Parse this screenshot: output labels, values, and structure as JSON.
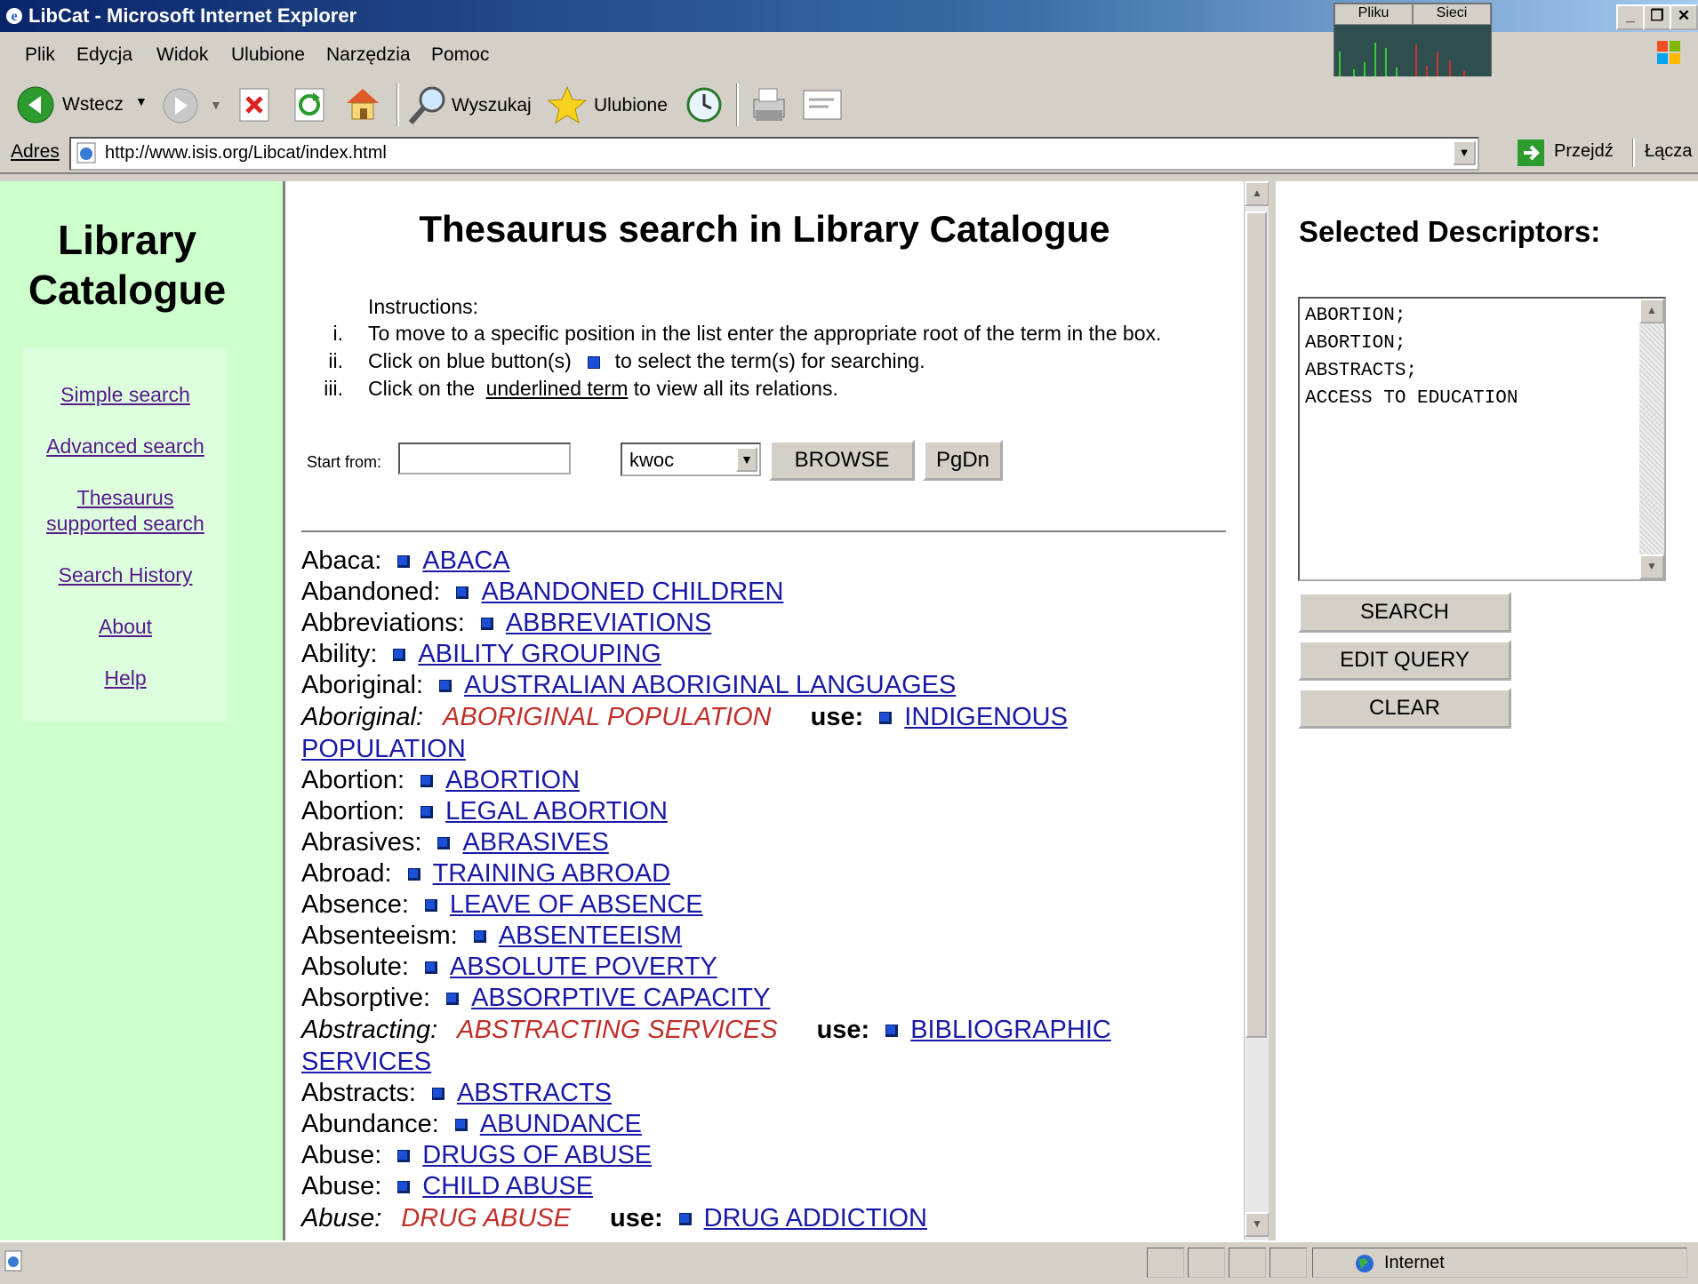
{
  "window": {
    "title": "LibCat - Microsoft Internet Explorer",
    "netmon_labels": [
      "Pliku",
      "Sieci"
    ],
    "buttons": [
      "_",
      "❐",
      "✕"
    ]
  },
  "menu": [
    "Plik",
    "Edycja",
    "Widok",
    "Ulubione",
    "Narzędzia",
    "Pomoc"
  ],
  "toolbar": {
    "back": "Wstecz",
    "search": "Wyszukaj",
    "favorites": "Ulubione"
  },
  "address": {
    "label": "Adres",
    "url": "http://www.isis.org/Libcat/index.html",
    "go": "Przejdź",
    "links": "Łącza"
  },
  "sidebar": {
    "title_line1": "Library",
    "title_line2": "Catalogue",
    "links": [
      "Simple search",
      "Advanced search",
      "Thesaurus",
      "supported search",
      "Search History",
      "About",
      "Help"
    ]
  },
  "main": {
    "title": "Thesaurus search in Library Catalogue",
    "instructions_heading": "Instructions:",
    "instructions": [
      {
        "num": "i.",
        "text": "To move to a specific position in the list enter the appropriate root of the term in the box."
      },
      {
        "num": "ii.",
        "text_before": "Click on blue button(s)",
        "text_after": "to select the term(s) for searching."
      },
      {
        "num": "iii.",
        "text_before": "Click on the",
        "link": "underlined term",
        "text_after": "to view all its relations."
      }
    ],
    "start_label": "Start from:",
    "start_value": "",
    "select_value": "kwoc",
    "browse": "BROWSE",
    "pgdn": "PgDn"
  },
  "entries": [
    {
      "key": "Abaca:",
      "term": "ABACA"
    },
    {
      "key": "Abandoned:",
      "term": "ABANDONED CHILDREN"
    },
    {
      "key": "Abbreviations:",
      "term": "ABBREVIATIONS"
    },
    {
      "key": "Ability:",
      "term": "ABILITY GROUPING"
    },
    {
      "key": "Aboriginal:",
      "term": "AUSTRALIAN ABORIGINAL LANGUAGES"
    },
    {
      "key": "Aboriginal:",
      "nonpref": "ABORIGINAL POPULATION",
      "use": "use:",
      "term1": "INDIGENOUS",
      "term2": "POPULATION"
    },
    {
      "key": "Abortion:",
      "term": "ABORTION"
    },
    {
      "key": "Abortion:",
      "term": "LEGAL ABORTION"
    },
    {
      "key": "Abrasives:",
      "term": "ABRASIVES"
    },
    {
      "key": "Abroad:",
      "term": "TRAINING ABROAD"
    },
    {
      "key": "Absence:",
      "term": "LEAVE OF ABSENCE"
    },
    {
      "key": "Absenteeism:",
      "term": "ABSENTEEISM"
    },
    {
      "key": "Absolute:",
      "term": "ABSOLUTE POVERTY"
    },
    {
      "key": "Absorptive:",
      "term": "ABSORPTIVE CAPACITY"
    },
    {
      "key": "Abstracting:",
      "nonpref": "ABSTRACTING SERVICES",
      "use": "use:",
      "term1": "BIBLIOGRAPHIC",
      "term2": "SERVICES"
    },
    {
      "key": "Abstracts:",
      "term": "ABSTRACTS"
    },
    {
      "key": "Abundance:",
      "term": "ABUNDANCE"
    },
    {
      "key": "Abuse:",
      "term": "DRUGS OF ABUSE"
    },
    {
      "key": "Abuse:",
      "term": "CHILD ABUSE"
    },
    {
      "key": "Abuse:",
      "nonpref": "DRUG ABUSE",
      "use": "use:",
      "term1": "DRUG ADDICTION"
    }
  ],
  "right": {
    "title": "Selected Descriptors:",
    "descriptors": [
      "ABORTION;",
      "ABORTION;",
      "ABSTRACTS;",
      "ACCESS TO EDUCATION"
    ],
    "search": "SEARCH",
    "edit": "EDIT QUERY",
    "clear": "CLEAR"
  },
  "status": {
    "zone": "Internet"
  }
}
